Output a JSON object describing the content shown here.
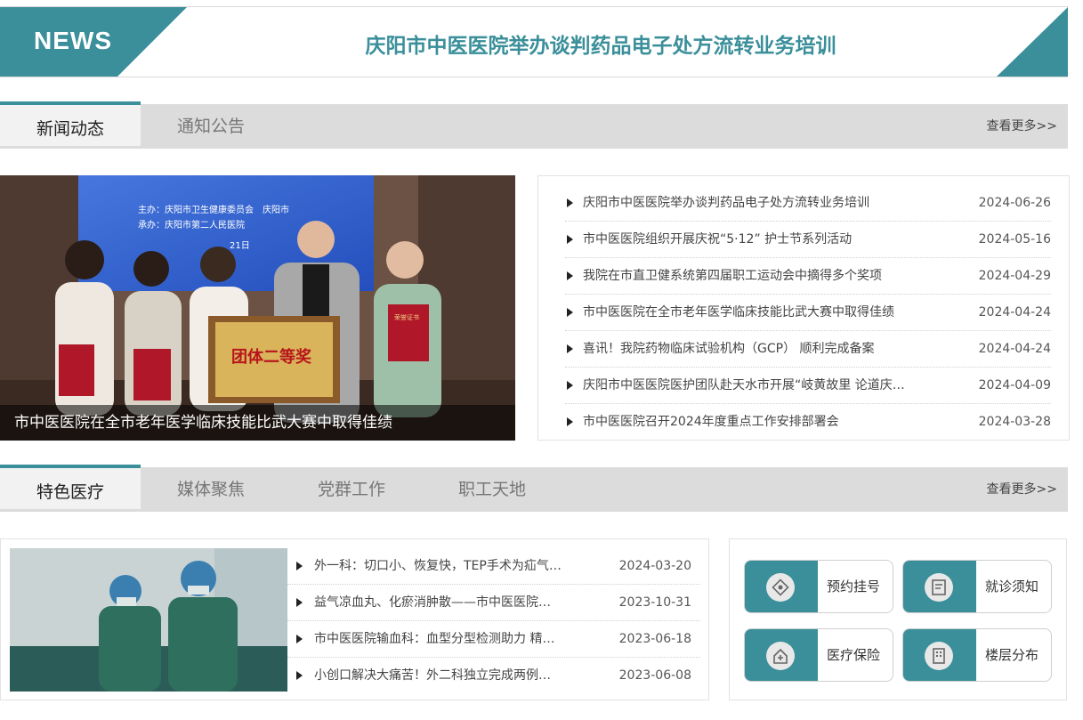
{
  "news_banner": {
    "tag": "NEWS",
    "headline": "庆阳市中医医院举办谈判药品电子处方流转业务培训",
    "accent_color": "#3a8f9a"
  },
  "tabs_top": {
    "tabs": [
      "新闻动态",
      "通知公告"
    ],
    "more": "查看更多>>"
  },
  "feature": {
    "caption": "市中医医院在全市老年医学临床技能比武大赛中取得佳绩",
    "screen_lines": [
      "主办：庆阳市卫生健康委员会　庆阳市",
      "承办：庆阳市第二人民医院",
      "21日"
    ],
    "plaque_text": "团体二等奖",
    "certificate_text": "荣誉证书"
  },
  "news_list": [
    {
      "title": "庆阳市中医医院举办谈判药品电子处方流转业务培训",
      "date": "2024-06-26"
    },
    {
      "title": "市中医医院组织开展庆祝“5·12” 护士节系列活动",
      "date": "2024-05-16"
    },
    {
      "title": "我院在市直卫健系统第四届职工运动会中摘得多个奖项",
      "date": "2024-04-29"
    },
    {
      "title": "市中医医院在全市老年医学临床技能比武大赛中取得佳绩",
      "date": "2024-04-24"
    },
    {
      "title": "喜讯！我院药物临床试验机构（GCP） 顺利完成备案",
      "date": "2024-04-24"
    },
    {
      "title": "庆阳市中医医院医护团队赴天水市开展“岐黄故里 论道庆…",
      "date": "2024-04-09"
    },
    {
      "title": "市中医医院召开2024年度重点工作安排部署会",
      "date": "2024-03-28"
    }
  ],
  "tabs_bottom": {
    "tabs": [
      "特色医疗",
      "媒体聚焦",
      "党群工作",
      "职工天地"
    ],
    "more": "查看更多>>"
  },
  "feature_list": [
    {
      "title": "外一科：切口小、恢复快，TEP手术为疝气…",
      "date": "2024-03-20"
    },
    {
      "title": "益气凉血丸、化瘀消肿散——市中医医院…",
      "date": "2023-10-31"
    },
    {
      "title": "市中医医院输血科：血型分型检测助力 精…",
      "date": "2023-06-18"
    },
    {
      "title": "小创口解决大痛苦！外二科独立完成两例…",
      "date": "2023-06-08"
    }
  ],
  "quick_links": [
    {
      "label": "预约挂号",
      "icon": "registration-icon"
    },
    {
      "label": "就诊须知",
      "icon": "notice-icon"
    },
    {
      "label": "医疗保险",
      "icon": "insurance-icon"
    },
    {
      "label": "楼层分布",
      "icon": "floor-map-icon"
    }
  ]
}
